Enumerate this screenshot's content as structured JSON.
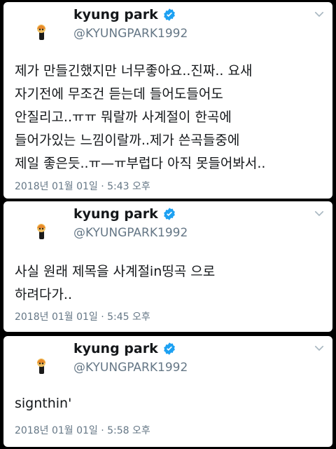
{
  "tweets": [
    {
      "name": "kyung park",
      "handle": "@KYUNGPARK1992",
      "text": "제가 만들긴했지만 너무좋아요..진짜.. 요새\n자기전에 무조건 듣는데 들어도들어도\n안질리고..ㅠㅠ 뭐랄까 사계절이 한곡에\n들어가있는 느낌이랄까..제가 쓴곡들중에\n제일 좋은듯..ㅠ—ㅠ부럽다 아직 못들어봐서..",
      "timestamp": "2018년 01월 01일 · 5:43 오후"
    },
    {
      "name": "kyung park",
      "handle": "@KYUNGPARK1992",
      "text": "사실 원래 제목을 사계절in띵곡 으로\n하려다가..",
      "timestamp": "2018년 01월 01일 · 5:45 오후"
    },
    {
      "name": "kyung park",
      "handle": "@KYUNGPARK1992",
      "text": "signthin'",
      "timestamp": "2018년 01월 01일 · 5:58 오후"
    }
  ],
  "icons": {
    "verified": "verified-badge-icon",
    "menu": "chevron-down-icon",
    "avatar": "profile-avatar"
  },
  "colors": {
    "verified": "#1da1f2",
    "text": "#14171a",
    "secondary": "#657786",
    "background": "#000000",
    "card": "#ffffff"
  }
}
